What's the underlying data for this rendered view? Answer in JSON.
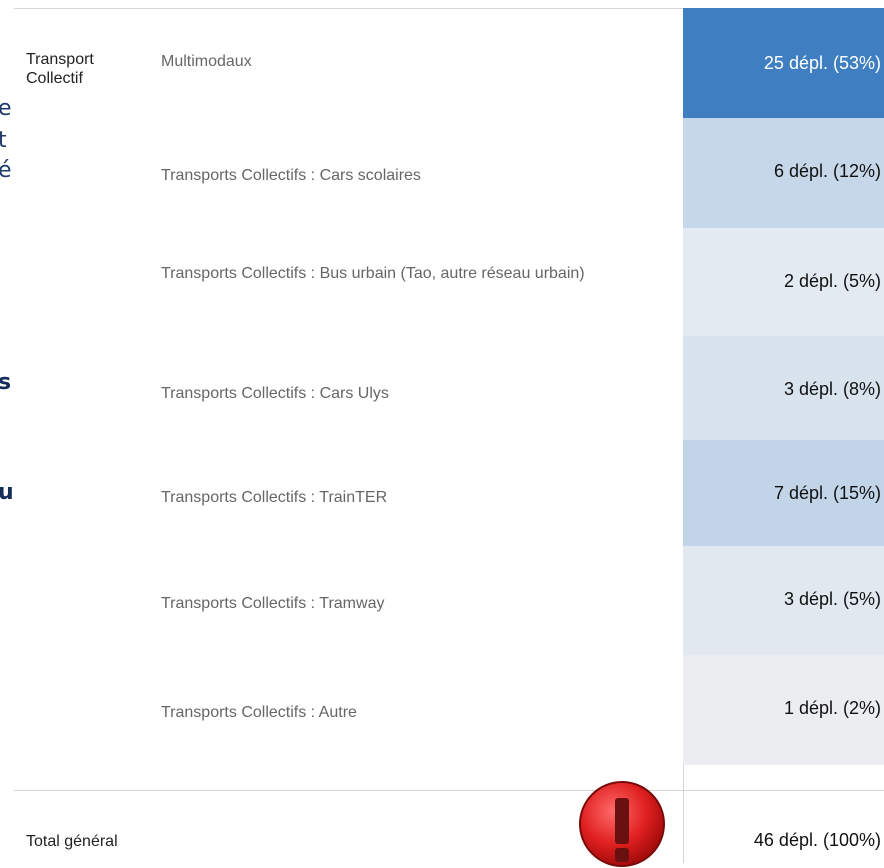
{
  "left_fragments": [
    {
      "text": "e",
      "bold": false
    },
    {
      "text": "t",
      "bold": false
    },
    {
      "text": "é",
      "bold": false
    },
    {
      "text": "s",
      "bold": true
    },
    {
      "text": "u",
      "bold": true
    }
  ],
  "table": {
    "group_label": "Transport Collectif",
    "rows": [
      {
        "label": "Multimodaux",
        "value": "25 dépl.  (53%)",
        "fill": 0.53,
        "bg": "#3f7fc1",
        "fg": "#ffffff"
      },
      {
        "label": "Transports Collectifs : Cars scolaires",
        "value": "6 dépl.  (12%)",
        "fill": 0.12,
        "bg": "#c6d7e9",
        "fg": "#111111"
      },
      {
        "label": "Transports Collectifs : Bus urbain (Tao, autre réseau urbain)",
        "value": "2 dépl.  (5%)",
        "fill": 0.05,
        "bg": "#e4eaf1",
        "fg": "#111111"
      },
      {
        "label": "Transports Collectifs : Cars Ulys",
        "value": "3 dépl.  (8%)",
        "fill": 0.08,
        "bg": "#d9e3ee",
        "fg": "#111111"
      },
      {
        "label": "Transports Collectifs : TrainTER",
        "value": "7 dépl.  (15%)",
        "fill": 0.15,
        "bg": "#c2d4e8",
        "fg": "#111111"
      },
      {
        "label": "Transports Collectifs : Tramway",
        "value": "3 dépl.  (5%)",
        "fill": 0.05,
        "bg": "#e2e8f0",
        "fg": "#111111"
      },
      {
        "label": "Transports Collectifs : Autre",
        "value": "1 dépl.  (2%)",
        "fill": 0.02,
        "bg": "#ebedf0",
        "fg": "#111111"
      }
    ],
    "total_label": "Total général",
    "total_value": "46 dépl.  (100%)"
  },
  "icons": {
    "warning": "warning-exclamation-icon"
  },
  "colors": {
    "accent": "#3f7fc1",
    "warning": "#e02020"
  }
}
